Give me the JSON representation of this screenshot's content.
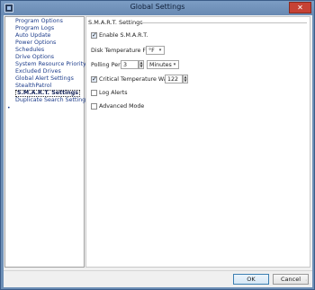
{
  "window": {
    "title": "Global Settings",
    "close_label": "✕"
  },
  "sidebar": {
    "items": [
      {
        "label": "Program Options"
      },
      {
        "label": "Program Logs"
      },
      {
        "label": "Auto Update"
      },
      {
        "label": "Power Options"
      },
      {
        "label": "Schedules"
      },
      {
        "label": "Drive Options"
      },
      {
        "label": "System Resource Priority"
      },
      {
        "label": "Excluded Drives"
      },
      {
        "label": "Global Alert Settings"
      },
      {
        "label": "StealthPatrol"
      },
      {
        "label": "S.M.A.R.T. Settings",
        "selected": true
      },
      {
        "label": "Duplicate Search Settings"
      }
    ],
    "selected_marker": "•"
  },
  "smart": {
    "section_title": "S.M.A.R.T. Settings",
    "enable_label": "Enable S.M.A.R.T.",
    "enable_checked": true,
    "disk_temp_label": "Disk Temperature Format",
    "disk_temp_value": "°F",
    "polling_label": "Polling Period",
    "polling_value": "3",
    "polling_unit": "Minutes",
    "critical_label": "Critical Temperature Warnings",
    "critical_checked": true,
    "critical_value": "122",
    "log_alerts_label": "Log Alerts",
    "log_alerts_checked": false,
    "advanced_label": "Advanced Mode",
    "advanced_checked": false
  },
  "footer": {
    "ok_label": "OK",
    "cancel_label": "Cancel"
  },
  "icons": {
    "dropdown": "▾",
    "spin_up": "▲",
    "spin_down": "▼",
    "grip": "⋱"
  }
}
